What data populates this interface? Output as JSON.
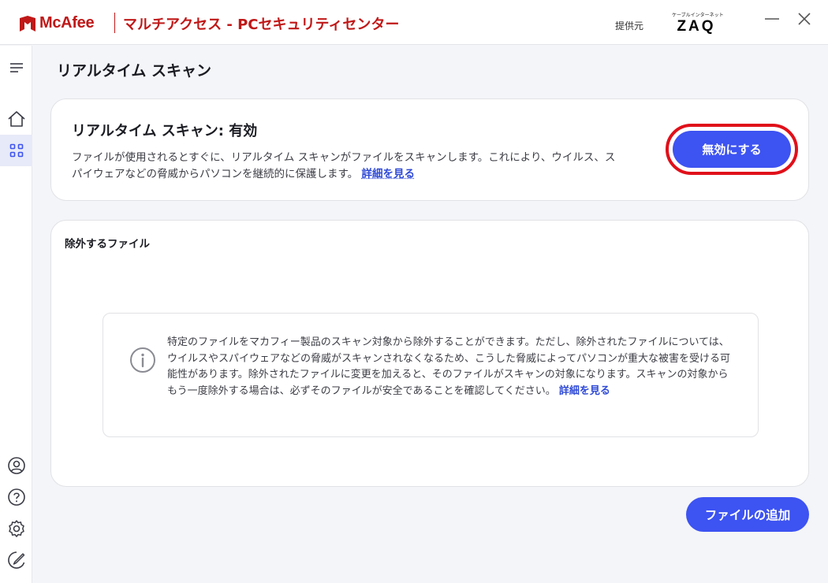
{
  "titlebar": {
    "brand": "McAfee",
    "app_title": "マルチアクセス - PCセキュリティセンター",
    "provider_label": "提供元",
    "provider_logo_small": "ケーブルインターネット",
    "provider_logo_main": "ZAQ",
    "minimize_icon": "minimize-icon",
    "close_icon": "close-icon"
  },
  "sidebar": {
    "items": [
      {
        "icon": "menu-icon"
      },
      {
        "icon": "home-icon"
      },
      {
        "icon": "apps-grid-icon",
        "active": true
      },
      {
        "icon": "account-icon"
      },
      {
        "icon": "help-icon"
      },
      {
        "icon": "settings-icon"
      },
      {
        "icon": "feedback-icon"
      }
    ]
  },
  "page": {
    "title": "リアルタイム スキャン"
  },
  "status_card": {
    "title": "リアルタイム スキャン: 有効",
    "description": "ファイルが使用されるとすぐに、リアルタイム スキャンがファイルをスキャンします。これにより、ウイルス、スパイウェアなどの脅威からパソコンを継続的に保護します。",
    "link": "詳細を見る",
    "button_label": "無効にする"
  },
  "exclusions_card": {
    "title": "除外するファイル",
    "info_text": "特定のファイルをマカフィー製品のスキャン対象から除外することができます。ただし、除外されたファイルについては、ウイルスやスパイウェアなどの脅威がスキャンされなくなるため、こうした脅威によってパソコンが重大な被害を受ける可能性があります。除外されたファイルに変更を加えると、そのファイルがスキャンの対象になります。スキャンの対象からもう一度除外する場合は、必ずそのファイルが安全であることを確認してください。",
    "info_link": "詳細を見る"
  },
  "footer": {
    "add_button": "ファイルの追加"
  },
  "colors": {
    "brand_red": "#c01818",
    "primary_blue": "#3d53f2",
    "link_blue": "#2f4ad6",
    "highlight_red": "#e0101a"
  }
}
